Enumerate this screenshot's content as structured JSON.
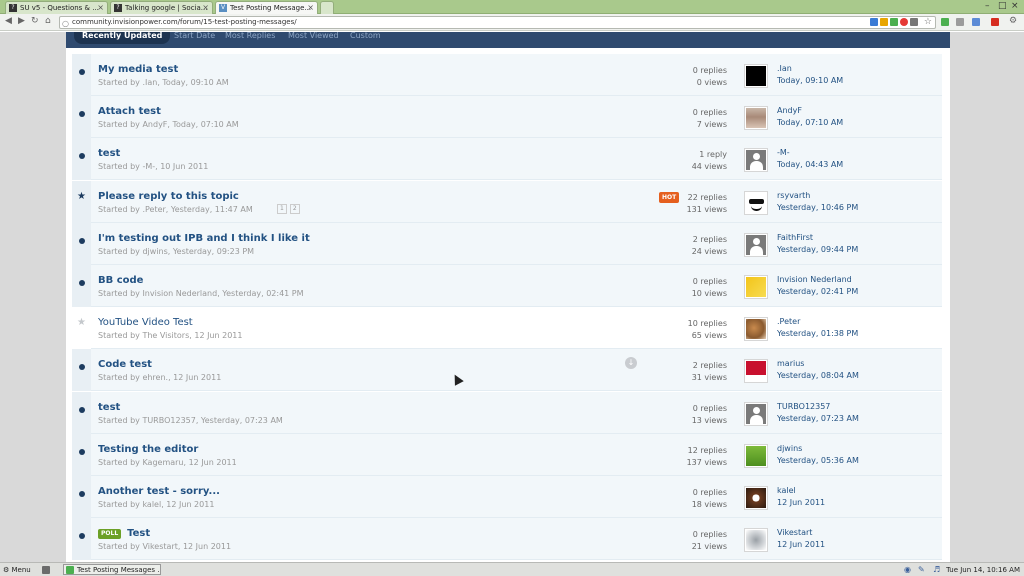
{
  "browser": {
    "tabs": [
      {
        "label": "SU v5 - Questions & ...",
        "fav": "?"
      },
      {
        "label": "Talking google | Socia...",
        "fav": "?"
      },
      {
        "label": "Test Posting Message...",
        "fav": "V",
        "active": true
      }
    ],
    "url": "community.invisionpower.com/forum/15-test-posting-messages/"
  },
  "filters": [
    "Recently Updated",
    "Start Date",
    "Most Replies",
    "Most Viewed",
    "Custom"
  ],
  "topics": [
    {
      "title": "My media test",
      "started": "Started by .Ian, Today, 09:10 AM",
      "replies": "0 replies",
      "views": "0 views",
      "last_poster": ".Ian",
      "last_date": "Today, 09:10 AM",
      "avatar": "qr",
      "marker": "dot"
    },
    {
      "title": "Attach test",
      "started": "Started by AndyF, Today, 07:10 AM",
      "replies": "0 replies",
      "views": "7 views",
      "last_poster": "AndyF",
      "last_date": "Today, 07:10 AM",
      "avatar": "photo",
      "marker": "dot"
    },
    {
      "title": "test",
      "started": "Started by -M-, 10 Jun 2011",
      "replies": "1 reply",
      "views": "44 views",
      "last_poster": "-M-",
      "last_date": "Today, 04:43 AM",
      "avatar": "generic",
      "marker": "dot"
    },
    {
      "title": "Please reply to this topic",
      "started": "Started by .Peter, Yesterday, 11:47 AM",
      "replies": "22 replies",
      "views": "131 views",
      "last_poster": "rsyvarth",
      "last_date": "Yesterday, 10:46 PM",
      "avatar": "joker",
      "marker": "star",
      "hot": "HOT",
      "pages": [
        "1",
        "2"
      ]
    },
    {
      "title": "I'm testing out IPB and I think I like it",
      "started": "Started by djwins, Yesterday, 09:23 PM",
      "replies": "2 replies",
      "views": "24 views",
      "last_poster": "FaithFirst",
      "last_date": "Yesterday, 09:44 PM",
      "avatar": "generic",
      "marker": "dot"
    },
    {
      "title": "BB code",
      "started": "Started by Invision Nederland, Yesterday, 02:41 PM",
      "replies": "0 replies",
      "views": "10 views",
      "last_poster": "Invision Nederland",
      "last_date": "Yesterday, 02:41 PM",
      "avatar": "yellow",
      "marker": "dot"
    },
    {
      "title": "YouTube Video Test",
      "started": "Started by The Visitors, 12 Jun 2011",
      "replies": "10 replies",
      "views": "65 views",
      "last_poster": ".Peter",
      "last_date": "Yesterday, 01:38 PM",
      "avatar": "peter",
      "marker": "star-read"
    },
    {
      "title": "Code test",
      "started": "Started by ehren., 12 Jun 2011",
      "replies": "2 replies",
      "views": "31 views",
      "last_poster": "marius",
      "last_date": "Yesterday, 08:04 AM",
      "avatar": "red",
      "marker": "dot",
      "preview": true
    },
    {
      "title": "test",
      "started": "Started by TURBO12357, Yesterday, 07:23 AM",
      "replies": "0 replies",
      "views": "13 views",
      "last_poster": "TURBO12357",
      "last_date": "Yesterday, 07:23 AM",
      "avatar": "generic",
      "marker": "dot"
    },
    {
      "title": "Testing the editor",
      "started": "Started by Kagemaru, 12 Jun 2011",
      "replies": "12 replies",
      "views": "137 views",
      "last_poster": "djwins",
      "last_date": "Yesterday, 05:36 AM",
      "avatar": "green",
      "marker": "dot"
    },
    {
      "title": "Another test - sorry...",
      "started": "Started by kalel, 12 Jun 2011",
      "replies": "0 replies",
      "views": "18 views",
      "last_poster": "kalel",
      "last_date": "12 Jun 2011",
      "avatar": "dog",
      "marker": "dot"
    },
    {
      "title": "Test",
      "started": "Started by Vikestart, 12 Jun 2011",
      "replies": "0 replies",
      "views": "21 views",
      "last_poster": "Vikestart",
      "last_date": "12 Jun 2011",
      "avatar": "sketch",
      "marker": "dot",
      "poll": "POLL"
    }
  ],
  "taskbar": {
    "menu": "Menu",
    "task": "Test Posting Messages ...",
    "clock": "Tue Jun 14, 10:16 AM"
  },
  "colors": {
    "link": "#235283",
    "filterbar": "#2f4a6f",
    "hot": "#e55f1e",
    "poll": "#6ca026"
  }
}
